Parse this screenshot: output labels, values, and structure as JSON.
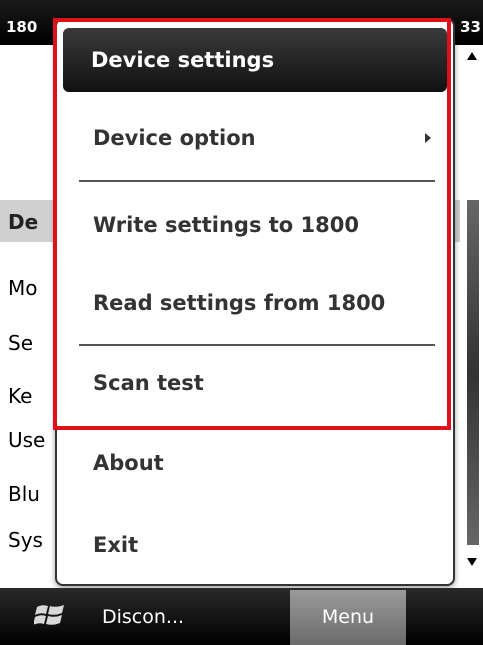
{
  "status": {
    "left_text": "180",
    "right_text": "33"
  },
  "background": {
    "header_label": "De",
    "items": [
      "Mo",
      "Se",
      "Ke",
      "Use",
      "Blu",
      "Sys"
    ]
  },
  "menu": {
    "items": [
      {
        "label": "Device settings",
        "highlighted": true
      },
      {
        "label": "Device option",
        "submenu": true
      },
      {
        "label": "Write settings to 1800"
      },
      {
        "label": "Read settings from 1800"
      },
      {
        "label": "Scan test"
      },
      {
        "label": "About"
      },
      {
        "label": "Exit"
      }
    ]
  },
  "softkeys": {
    "left": "Discon...",
    "right": "Menu"
  },
  "colors": {
    "highlight_rect": "#e0101a",
    "menu_highlight_bg": "#1e1e1e"
  },
  "icons": [
    "windows-logo-icon",
    "submenu-arrow-icon",
    "scroll-up-icon",
    "scroll-down-icon"
  ]
}
